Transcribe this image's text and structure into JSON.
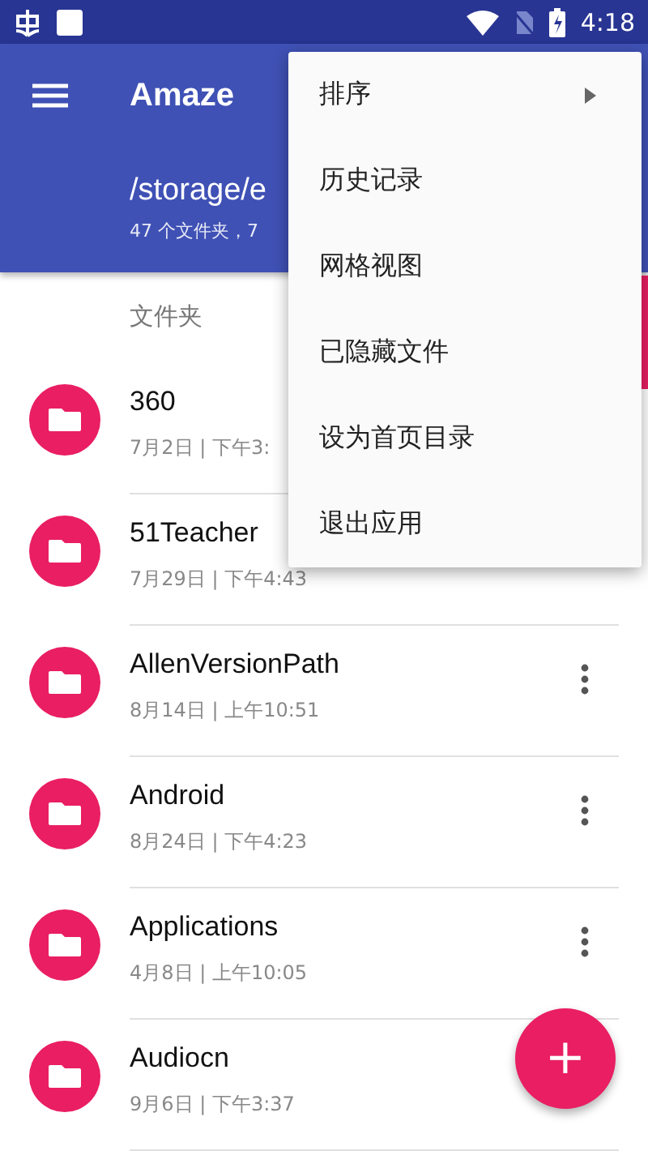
{
  "status_bar": {
    "time": "4:18"
  },
  "toolbar": {
    "title": "Amaze",
    "path": "/storage/e",
    "summary": "47 个文件夹，7"
  },
  "section_label": "文件夹",
  "files": [
    {
      "name": "360",
      "date": "7月2日 | 下午3:"
    },
    {
      "name": "51Teacher",
      "date": "7月29日 | 下午4:43"
    },
    {
      "name": "AllenVersionPath",
      "date": "8月14日 | 上午10:51",
      "more_button": true
    },
    {
      "name": "Android",
      "date": "8月24日 | 下午4:23",
      "more_button": true
    },
    {
      "name": "Applications",
      "date": "4月8日 | 上午10:05",
      "more_button": true
    },
    {
      "name": "Audiocn",
      "date": "9月6日 | 下午3:37"
    }
  ],
  "menu": [
    {
      "label": "排序",
      "submenu": true
    },
    {
      "label": "历史记录",
      "submenu": false
    },
    {
      "label": "网格视图",
      "submenu": false
    },
    {
      "label": "已隐藏文件",
      "submenu": false
    },
    {
      "label": "设为首页目录",
      "submenu": false
    },
    {
      "label": "退出应用",
      "submenu": false
    }
  ],
  "fab": {
    "label": "+"
  }
}
